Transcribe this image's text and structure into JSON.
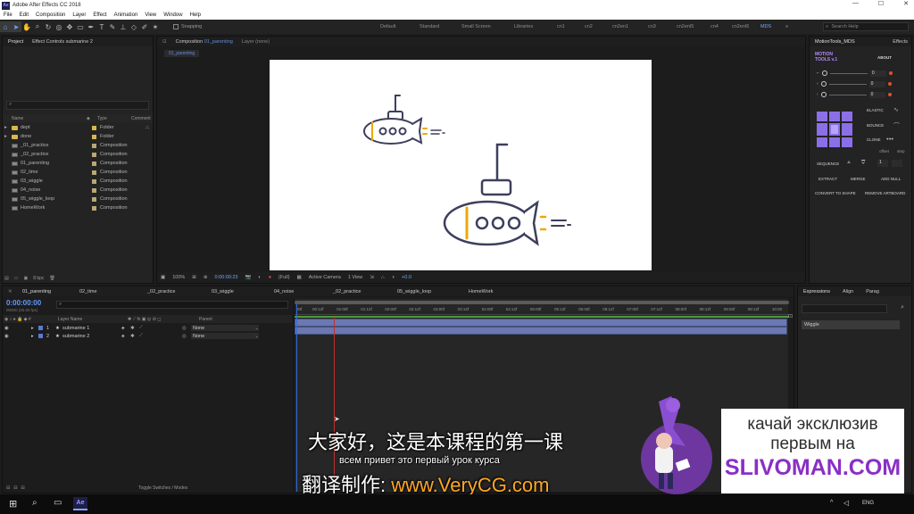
{
  "window": {
    "title": "Adobe After Effects CC 2018",
    "controls": [
      "—",
      "☐",
      "✕"
    ]
  },
  "menu": [
    "File",
    "Edit",
    "Composition",
    "Layer",
    "Effect",
    "Animation",
    "View",
    "Window",
    "Help"
  ],
  "toolbar": {
    "snapping_label": "Snapping",
    "workspaces": [
      "Default",
      "Standard",
      "Small Screen",
      "Libraries",
      "cn1",
      "cn2",
      "cn2en1",
      "cn3",
      "cn2enl5",
      "cn4",
      "cn2enl6",
      "MDS"
    ],
    "active_workspace": "MDS",
    "search_placeholder": "Search Help"
  },
  "project_panel": {
    "tab_label": "Project",
    "effect_controls_label": "Effect Controls submarine 2",
    "columns": {
      "name": "Name",
      "type": "Type",
      "comment": "Comment"
    },
    "items": [
      {
        "name": "dept",
        "type": "Folder",
        "kind": "folder"
      },
      {
        "name": "done",
        "type": "Folder",
        "kind": "folder"
      },
      {
        "name": "_01_practice",
        "type": "Composition",
        "kind": "comp"
      },
      {
        "name": "_02_practice",
        "type": "Composition",
        "kind": "comp"
      },
      {
        "name": "01_parenting",
        "type": "Composition",
        "kind": "comp"
      },
      {
        "name": "02_time",
        "type": "Composition",
        "kind": "comp"
      },
      {
        "name": "03_wiggle",
        "type": "Composition",
        "kind": "comp"
      },
      {
        "name": "04_noise",
        "type": "Composition",
        "kind": "comp"
      },
      {
        "name": "05_wiggle_loop",
        "type": "Composition",
        "kind": "comp"
      },
      {
        "name": "HomeWork",
        "type": "Composition",
        "kind": "comp"
      }
    ],
    "footer_bpc": "8 bpc"
  },
  "comp_panel": {
    "tab_label": "Composition",
    "comp_name": "01_parenting",
    "layer_tab": "Layer (none)",
    "subtab": "01_parenting",
    "zoom": "100%",
    "timecode": "0:00:00:23",
    "resolution": "(Full)",
    "camera": "Active Camera",
    "views": "1 View",
    "exposure": "+0.0"
  },
  "timeline": {
    "tabs": [
      "01_parenting",
      "02_time",
      "_02_practice",
      "03_wiggle",
      "04_noise",
      "_02_practice",
      "05_wiggle_loop",
      "HomeWork"
    ],
    "current_time": "0:00:00:00",
    "fps_note": "00000 (25.00 fps)",
    "columns": {
      "layer_name": "Layer Name",
      "parent": "Parent"
    },
    "layers": [
      {
        "num": "1",
        "name": "submarine 1",
        "parent": "None",
        "color": "#5a7ad6"
      },
      {
        "num": "2",
        "name": "submarine 2",
        "parent": "None",
        "color": "#5a7ad6"
      }
    ],
    "ruler": [
      "00:12f",
      "01:00f",
      "01:12f",
      "02:00f",
      "02:12f",
      "03:00f",
      "03:12f",
      "04:00f",
      "04:12f",
      "05:00f",
      "05:12f",
      "06:00f",
      "06:12f",
      "07:00f",
      "07:12f",
      "08:00f",
      "08:12f",
      "09:00f",
      "09:12f",
      "10:00"
    ],
    "ruler_start": "00f",
    "toggle_label": "Toggle Switches / Modes"
  },
  "motiontools": {
    "tab_label": "MotionTools_MDS",
    "effects_tab": "Effects",
    "title": "MOTION TOOLS v.1",
    "about": "ABOUT",
    "values": [
      "0",
      "0",
      "0"
    ],
    "buttons": {
      "elastic": "ELASTIC",
      "bounce": "BOUNCE",
      "clone": "CLONE",
      "offset": "offset",
      "step": "step",
      "sequence": "SEQUENCE",
      "seq_value": "1",
      "extract": "EXTRACT",
      "merge": "MERGE",
      "add_null": "ADD NULL",
      "convert": "CONVERT TO SHAPE",
      "remove_artboard": "REMOVE ARTBOARD"
    }
  },
  "expressions_panel": {
    "tabs": [
      "Expressions",
      "Align",
      "Parag"
    ],
    "item": "Wiggle"
  },
  "subtitles": {
    "cn_line": "大家好，这是本课程的第一课",
    "ru_line": "всем привет это первый урок курса",
    "credit_prefix": "翻译制作: ",
    "credit_url": "www.VeryCG.com"
  },
  "promo": {
    "line1": "качай эксклюзив",
    "line2": "первым на",
    "site": "SLIVOMAN.COM"
  },
  "taskbar": {
    "lang": "ENG",
    "app": "Ae"
  },
  "colors": {
    "accent": "#5f8ddf",
    "sub_outline": "#3d3f5c",
    "sub_window": "#f0a800",
    "promo_purple": "#7a3bb5",
    "promo_site": "#8a2fc6"
  }
}
